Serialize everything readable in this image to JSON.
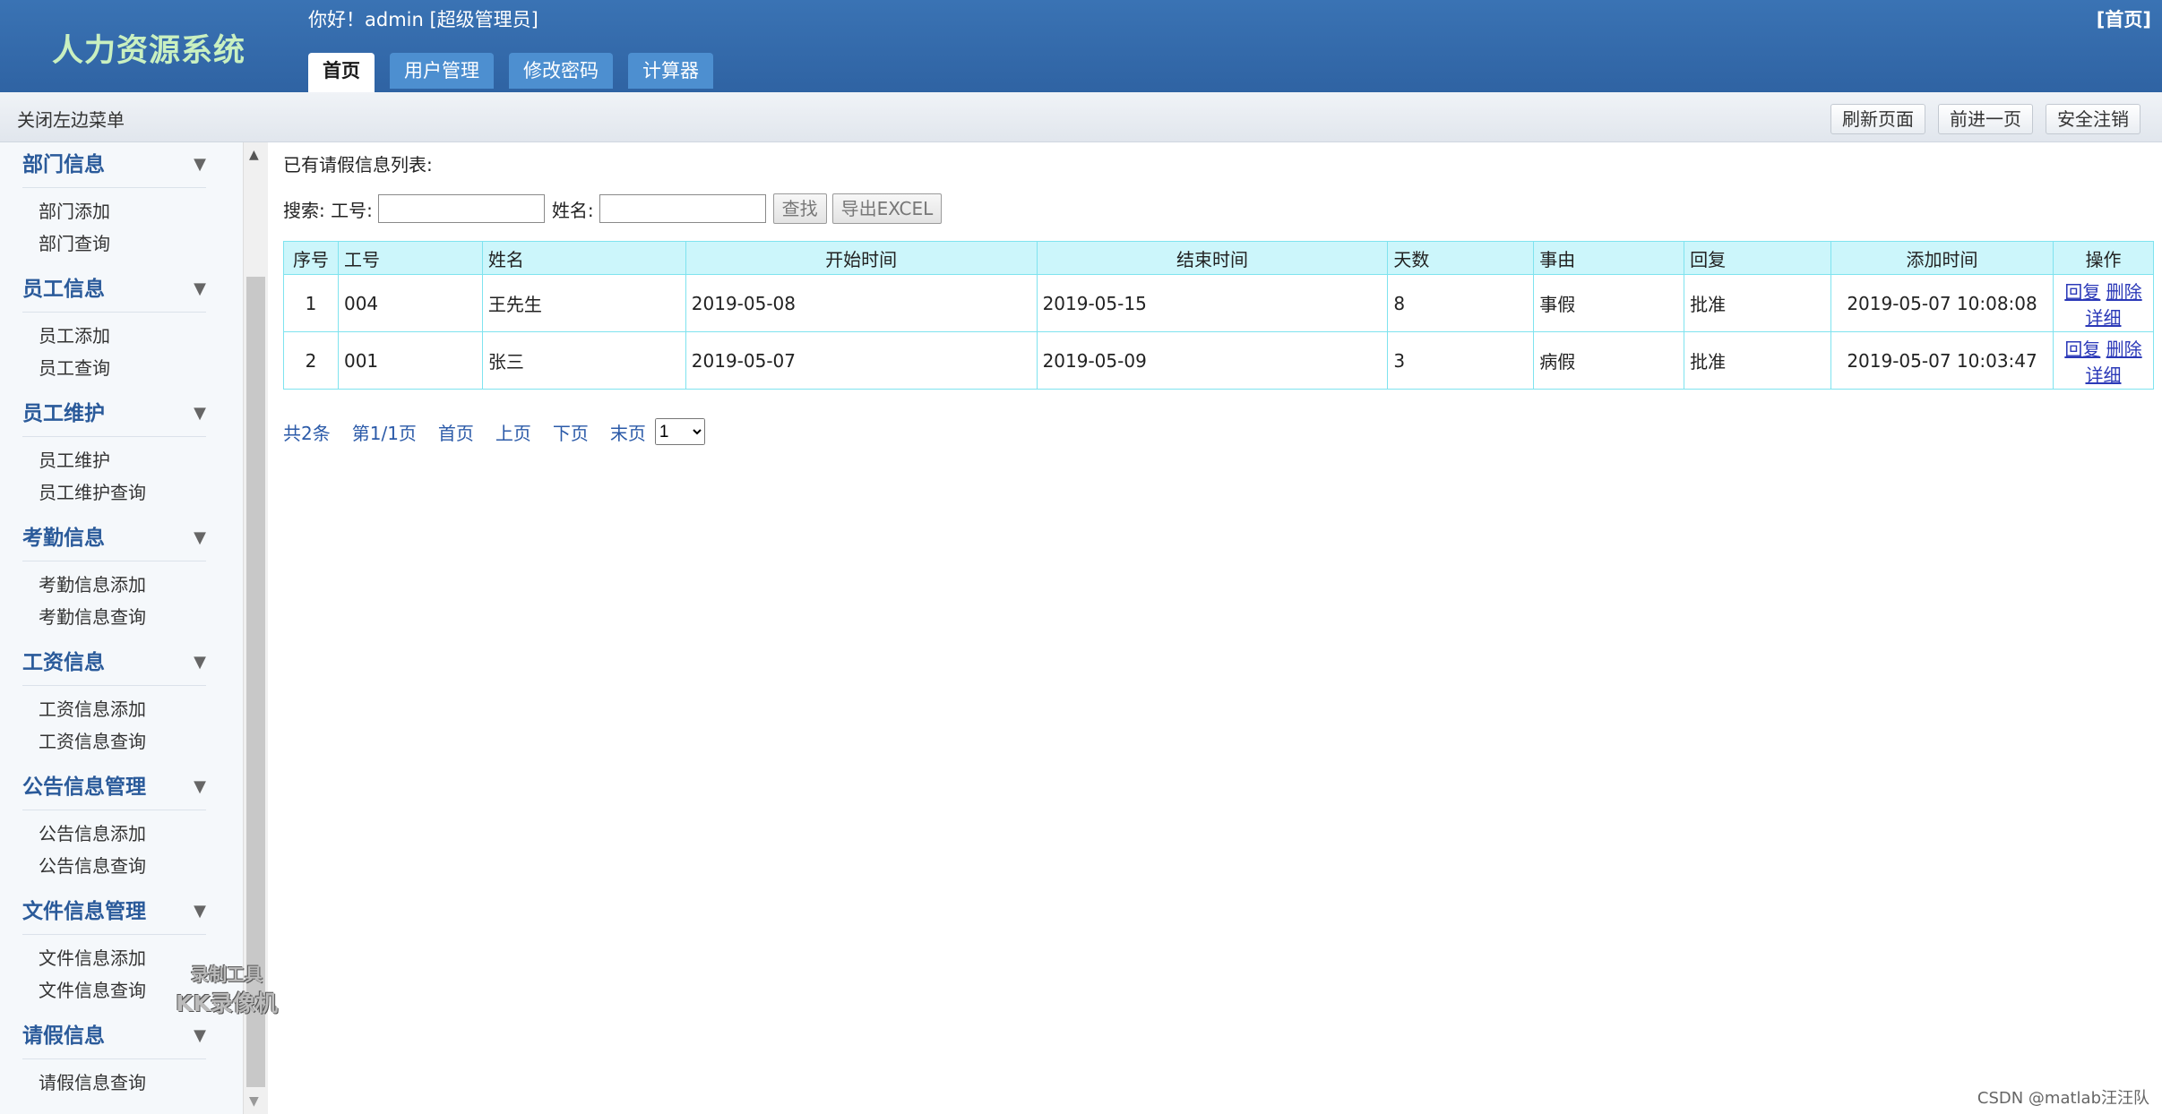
{
  "header": {
    "logo": "人力资源系统",
    "greeting": "你好！admin [超级管理员]",
    "home_link": "[首页]",
    "tabs": [
      "首页",
      "用户管理",
      "修改密码",
      "计算器"
    ]
  },
  "toolbar": {
    "close_menu": "关闭左边菜单",
    "buttons": [
      "刷新页面",
      "前进一页",
      "安全注销"
    ]
  },
  "sidebar": {
    "sections": [
      {
        "title": "部门信息",
        "items": [
          "部门添加",
          "部门查询"
        ]
      },
      {
        "title": "员工信息",
        "items": [
          "员工添加",
          "员工查询"
        ]
      },
      {
        "title": "员工维护",
        "items": [
          "员工维护",
          "员工维护查询"
        ]
      },
      {
        "title": "考勤信息",
        "items": [
          "考勤信息添加",
          "考勤信息查询"
        ]
      },
      {
        "title": "工资信息",
        "items": [
          "工资信息添加",
          "工资信息查询"
        ]
      },
      {
        "title": "公告信息管理",
        "items": [
          "公告信息添加",
          "公告信息查询"
        ]
      },
      {
        "title": "文件信息管理",
        "items": [
          "文件信息添加",
          "文件信息查询"
        ]
      },
      {
        "title": "请假信息",
        "items": [
          "请假信息查询"
        ]
      }
    ],
    "arrow": "▼"
  },
  "main": {
    "list_title": "已有请假信息列表:",
    "search": {
      "label": "搜索: 工号:",
      "name_label": "姓名:",
      "id_value": "",
      "name_value": "",
      "find_button": "查找",
      "export_button": "导出EXCEL"
    },
    "table": {
      "headers": [
        "序号",
        "工号",
        "姓名",
        "开始时间",
        "结束时间",
        "天数",
        "事由",
        "回复",
        "添加时间",
        "操作"
      ],
      "rows": [
        {
          "no": "1",
          "id": "004",
          "name": "王先生",
          "start": "2019-05-08",
          "end": "2019-05-15",
          "days": "8",
          "reason": "事假",
          "reply": "批准",
          "added": "2019-05-07 10:08:08"
        },
        {
          "no": "2",
          "id": "001",
          "name": "张三",
          "start": "2019-05-07",
          "end": "2019-05-09",
          "days": "3",
          "reason": "病假",
          "reply": "批准",
          "added": "2019-05-07 10:03:47"
        }
      ],
      "actions": {
        "reply": "回复",
        "delete": "删除",
        "detail": "详细"
      }
    },
    "pager": {
      "total": "共2条",
      "page": "第1/1页",
      "first": "首页",
      "prev": "上页",
      "next": "下页",
      "last": "末页",
      "selected": "1"
    }
  },
  "watermark": {
    "line1": "录制工具",
    "line2": "KK录像机"
  },
  "footer_watermark": "CSDN @matlab汪汪队"
}
